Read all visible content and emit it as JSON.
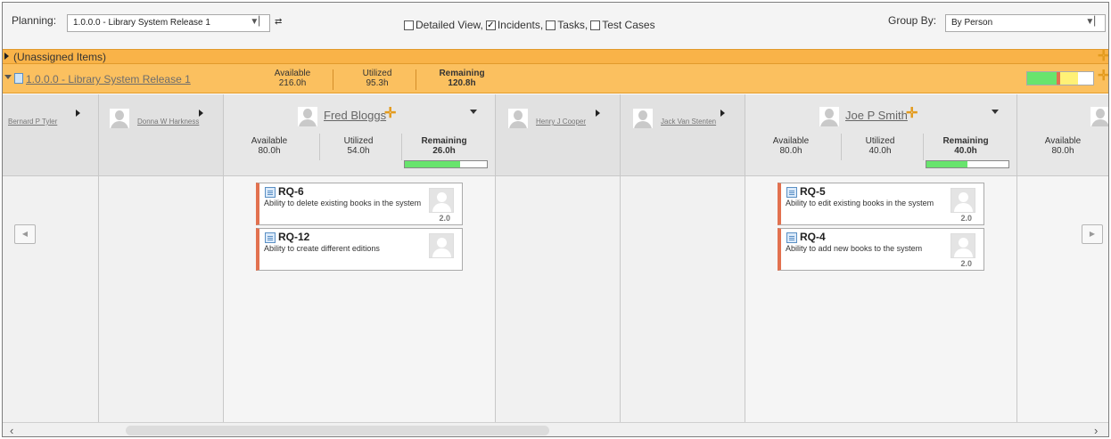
{
  "toolbar": {
    "planning_label": "Planning:",
    "planning_value": "1.0.0.0 - Library System Release 1",
    "detailed_view_label": "Detailed View,",
    "detailed_view_checked": false,
    "incidents_label": "Incidents,",
    "incidents_checked": true,
    "tasks_label": "Tasks,",
    "tasks_checked": false,
    "test_cases_label": "Test Cases",
    "test_cases_checked": false,
    "group_by_label": "Group By:",
    "group_by_value": "By Person"
  },
  "unassigned": {
    "label": "(Unassigned Items)"
  },
  "release": {
    "name": "1.0.0.0 - Library System Release 1",
    "available_label": "Available",
    "available_value": "216.0h",
    "utilized_label": "Utilized",
    "utilized_value": "95.3h",
    "remaining_label": "Remaining",
    "remaining_value": "120.8h",
    "progress_segments": [
      {
        "color": "#68e46d",
        "fraction": 0.44
      },
      {
        "color": "#e2714f",
        "fraction": 0.06
      },
      {
        "color": "#fff176",
        "fraction": 0.27
      },
      {
        "color": "#ffffff",
        "fraction": 0.23
      }
    ]
  },
  "people": {
    "bernard": {
      "name": "Bernard P Tyler"
    },
    "donna": {
      "name": "Donna W Harkness"
    },
    "fred": {
      "name": "Fred Bloggs",
      "available_label": "Available",
      "available_value": "80.0h",
      "utilized_label": "Utilized",
      "utilized_value": "54.0h",
      "remaining_label": "Remaining",
      "remaining_value": "26.0h",
      "progress_fraction": 0.67
    },
    "henry": {
      "name": "Henry J Cooper"
    },
    "jack": {
      "name": "Jack Van Stenten"
    },
    "joe": {
      "name": "Joe P Smith",
      "available_label": "Available",
      "available_value": "80.0h",
      "utilized_label": "Utilized",
      "utilized_value": "40.0h",
      "remaining_label": "Remaining",
      "remaining_value": "40.0h",
      "progress_fraction": 0.5
    },
    "partial": {
      "available_label": "Available",
      "available_value": "80.0h"
    }
  },
  "cards": {
    "rq6": {
      "id": "RQ-6",
      "desc": "Ability to delete existing books in the system",
      "estimate": "2.0"
    },
    "rq12": {
      "id": "RQ-12",
      "desc": "Ability to create different editions",
      "estimate": ""
    },
    "rq5": {
      "id": "RQ-5",
      "desc": "Ability to edit existing books in the system",
      "estimate": "2.0"
    },
    "rq4": {
      "id": "RQ-4",
      "desc": "Ability to add new books to the system",
      "estimate": "2.0"
    }
  },
  "icons": {
    "refresh": "refresh-icon",
    "add": "plus-icon",
    "requirement": "requirement-icon",
    "nav_prev": "arrow-left-icon",
    "nav_next": "arrow-right-icon"
  }
}
